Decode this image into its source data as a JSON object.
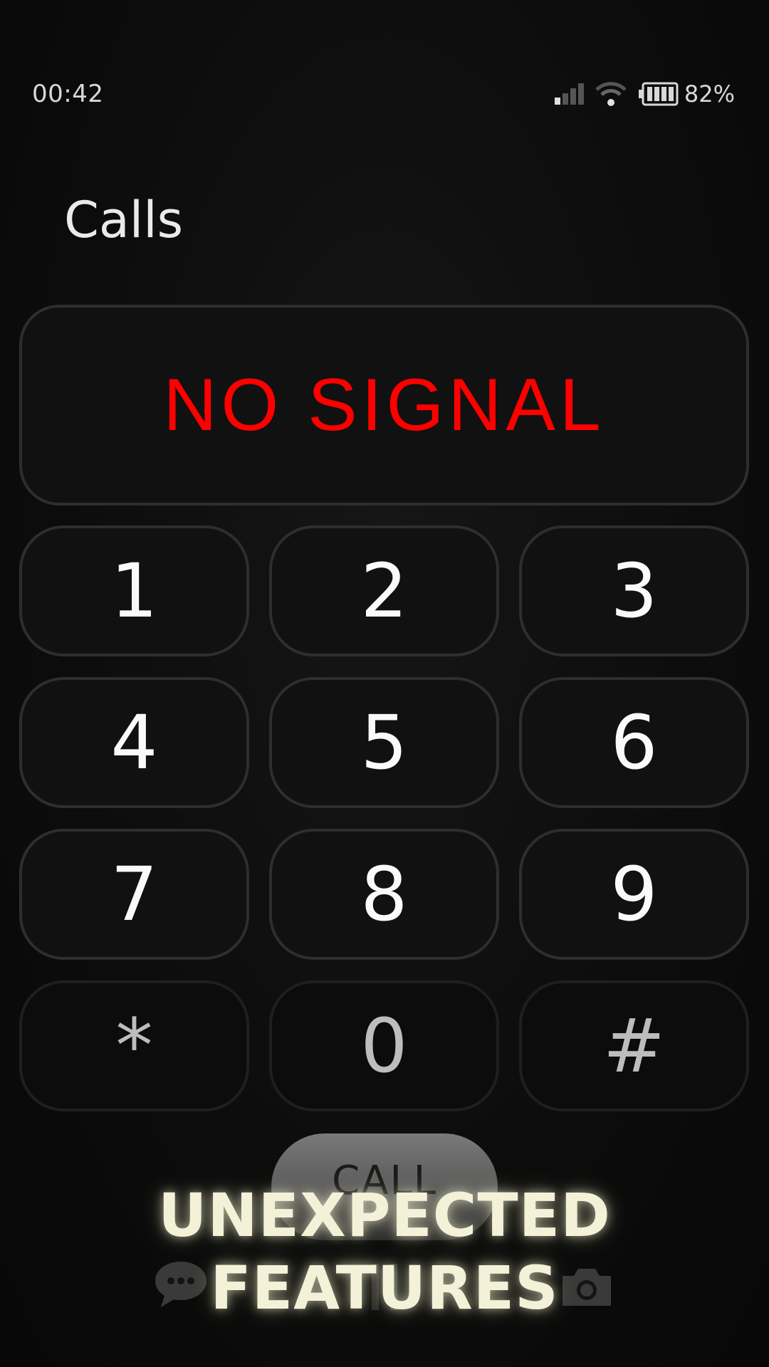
{
  "status_bar": {
    "time": "00:42",
    "battery": "82%",
    "icons": [
      "signal-icon",
      "wifi-icon",
      "battery-icon"
    ]
  },
  "app": {
    "title": "Calls"
  },
  "display": {
    "text": "NO SIGNAL",
    "color": "#ff0000"
  },
  "keypad": {
    "keys": [
      "1",
      "2",
      "3",
      "4",
      "5",
      "6",
      "7",
      "8",
      "9",
      "*",
      "0",
      "#"
    ]
  },
  "call_button": {
    "label": "CALL"
  },
  "bottom_icons": [
    "chat-icon",
    "home-icon",
    "camera-icon"
  ],
  "overlay": {
    "line1": "UNEXPECTED",
    "line2": "FEATURES"
  }
}
